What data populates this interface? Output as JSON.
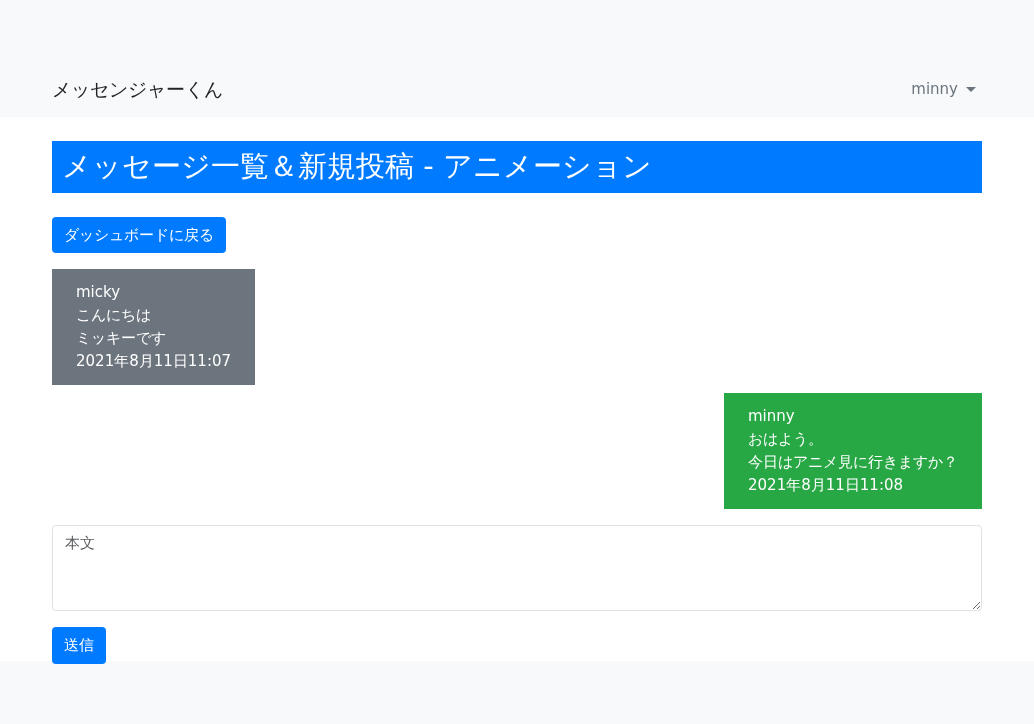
{
  "navbar": {
    "brand": "メッセンジャーくん",
    "user_menu": "minny"
  },
  "heading": "メッセージ一覧＆新規投稿 - アニメーション",
  "back_button": "ダッシュボードに戻る",
  "messages": [
    {
      "kind": "received",
      "sender": "micky",
      "lines": [
        "こんにちは",
        "ミッキーです"
      ],
      "time": "2021年8月11日11:07"
    },
    {
      "kind": "sent",
      "sender": "minny",
      "lines": [
        "おはよう。",
        "今日はアニメ見に行きますか？"
      ],
      "time": "2021年8月11日11:08"
    }
  ],
  "composer": {
    "placeholder": "本文"
  },
  "send_button": "送信"
}
